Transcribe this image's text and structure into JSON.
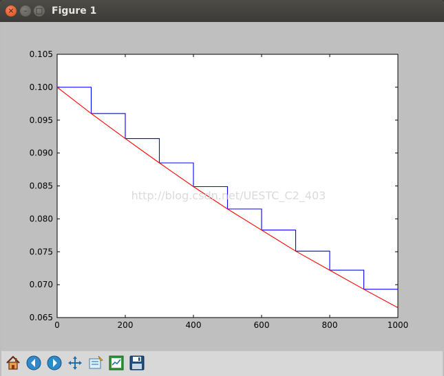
{
  "window": {
    "title": "Figure 1",
    "close_glyph": "×",
    "min_glyph": "–",
    "max_glyph": "□"
  },
  "watermark": "http://blog.csdn.net/UESTC_C2_403",
  "toolbar": [
    {
      "name": "home-icon"
    },
    {
      "name": "back-icon"
    },
    {
      "name": "forward-icon"
    },
    {
      "name": "pan-icon"
    },
    {
      "name": "zoom-rect-icon"
    },
    {
      "name": "subplots-config-icon"
    },
    {
      "name": "save-icon"
    }
  ],
  "chart_data": {
    "type": "line",
    "title": "",
    "xlabel": "",
    "ylabel": "",
    "xlim": [
      0,
      1000
    ],
    "ylim": [
      0.065,
      0.105
    ],
    "xticks": [
      "0",
      "200",
      "400",
      "600",
      "800",
      "1000"
    ],
    "yticks": [
      "0.065",
      "0.070",
      "0.075",
      "0.080",
      "0.085",
      "0.090",
      "0.095",
      "0.100",
      "0.105"
    ],
    "grid": false,
    "series": [
      {
        "color": "#0000ff",
        "style": "step",
        "x": [
          0,
          100,
          100,
          200,
          200,
          300,
          300,
          400,
          400,
          500,
          500,
          600,
          600,
          700,
          700,
          800,
          800,
          900,
          900,
          1000
        ],
        "y": [
          0.1,
          0.1,
          0.096,
          0.096,
          0.0922,
          0.0922,
          0.0885,
          0.0885,
          0.0849,
          0.0849,
          0.0815,
          0.0815,
          0.0783,
          0.0783,
          0.0751,
          0.0751,
          0.0722,
          0.0722,
          0.0693,
          0.0693
        ]
      },
      {
        "color": "#ff0000",
        "style": "smooth",
        "x": [
          0,
          100,
          200,
          300,
          400,
          500,
          600,
          700,
          800,
          900,
          1000
        ],
        "y": [
          0.1,
          0.096,
          0.0922,
          0.0885,
          0.0849,
          0.0815,
          0.0783,
          0.0751,
          0.0722,
          0.0693,
          0.0665
        ]
      }
    ]
  }
}
